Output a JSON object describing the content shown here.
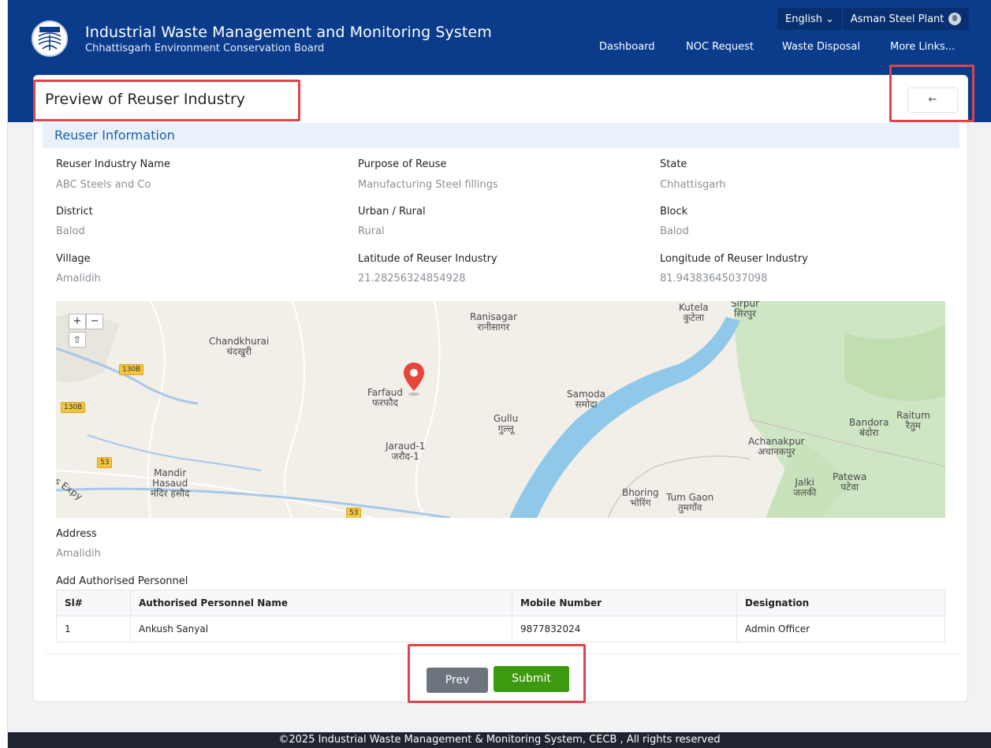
{
  "header": {
    "title": "Industrial Waste Management and Monitoring System",
    "subtitle": "Chhattisgarh Environment Conservation Board",
    "language": "English",
    "user": "Asman Steel Plant",
    "nav": [
      "Dashboard",
      "NOC Request",
      "Waste Disposal",
      "More Links..."
    ]
  },
  "page": {
    "title": "Preview of Reuser Industry",
    "back_icon": "←"
  },
  "section": {
    "title": "Reuser Information"
  },
  "fields": {
    "reuser_name": {
      "label": "Reuser Industry Name",
      "value": "ABC Steels and Co"
    },
    "purpose": {
      "label": "Purpose of Reuse",
      "value": "Manufacturing Steel fillings"
    },
    "state": {
      "label": "State",
      "value": "Chhattisgarh"
    },
    "district": {
      "label": "District",
      "value": "Balod"
    },
    "urban_rural": {
      "label": "Urban / Rural",
      "value": "Rural"
    },
    "block": {
      "label": "Block",
      "value": "Balod"
    },
    "village": {
      "label": "Village",
      "value": "Amalidih"
    },
    "latitude": {
      "label": "Latitude of Reuser Industry",
      "value": "21.28256324854928"
    },
    "longitude": {
      "label": "Longitude of Reuser Industry",
      "value": "81.94383645037098"
    },
    "address": {
      "label": "Address",
      "value": "Amalidih"
    }
  },
  "map": {
    "zoom_in": "+",
    "zoom_out": "−",
    "reset": "⇧",
    "places": {
      "chandkhurai": "Chandkhurai",
      "chandkhurai_hi": "चंदखुरी",
      "ranisagar": "Ranisagar",
      "ranisagar_hi": "रानीसागर",
      "kutela": "Kutela",
      "kutela_hi": "कुटेला",
      "sirpur": "Sirpur",
      "sirpur_hi": "सिरपुर",
      "farfaud": "Farfaud",
      "farfaud_hi": "फरफौद",
      "samoda": "Samoda",
      "samoda_hi": "समोदा",
      "gullu": "Gullu",
      "gullu_hi": "गुल्लू",
      "jaraud": "Jaraud-1",
      "jaraud_hi": "जरौद-1",
      "mandir": "Mandir",
      "hasaud": "Hasaud",
      "mandir_hi": "मंदिर हसौद",
      "bhoring": "Bhoring",
      "bhoring_hi": "भोरिंग",
      "tumgaon": "Tum Gaon",
      "tumgaon_hi": "तुमगाँव",
      "achanakpur": "Achanakpur",
      "achanakpur_hi": "अचानकपुर",
      "bandora": "Bandora",
      "bandora_hi": "बंदोरा",
      "raitum": "Raitum",
      "raitum_hi": "रैतुम",
      "jalki": "Jalki",
      "jalki_hi": "जलकी",
      "patewa": "Patewa",
      "patewa_hi": "पटेवा",
      "expy": "s Expy"
    },
    "shields": [
      "130B",
      "130B",
      "53",
      "53"
    ]
  },
  "personnel": {
    "label": "Add Authorised Personnel",
    "columns": [
      "Sl#",
      "Authorised Personnel Name",
      "Mobile Number",
      "Designation"
    ],
    "rows": [
      [
        "1",
        "Ankush Sanyal",
        "9877832024",
        "Admin Officer"
      ]
    ]
  },
  "buttons": {
    "prev": "Prev",
    "submit": "Submit"
  },
  "footer": "©2025 Industrial Waste Management & Monitoring System, CECB , All rights reserved",
  "colors": {
    "header": "#0b3c8c",
    "submit": "#3d9a10",
    "prev": "#6c757d",
    "highlight": "#e0444b",
    "section": "#e9f2fb"
  }
}
